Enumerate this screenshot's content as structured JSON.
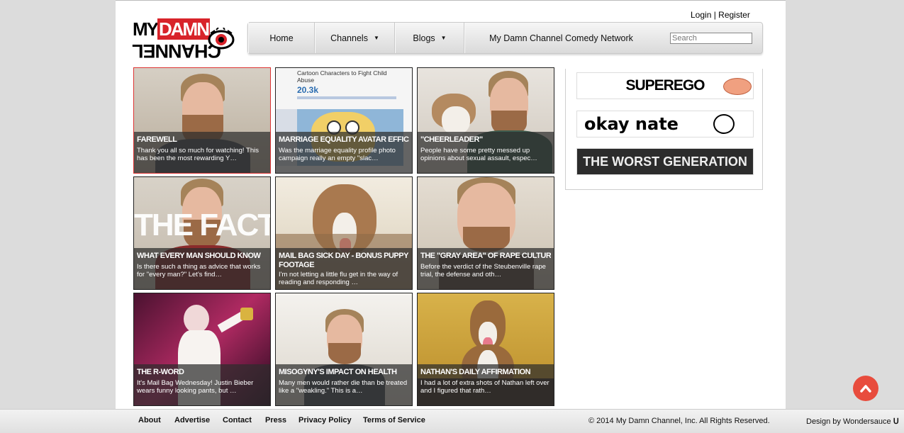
{
  "header": {
    "logo": {
      "word_top_black": "MY",
      "word_top_red": "DAMN",
      "word_bottom": "CHANNEL"
    },
    "login_label": "Login",
    "separator": " | ",
    "register_label": "Register"
  },
  "nav": {
    "home": "Home",
    "channels": "Channels",
    "blogs": "Blogs",
    "network": "My Damn Channel Comedy Network",
    "search_placeholder": "Search",
    "caret": "▼"
  },
  "videos": [
    {
      "title": "Farewell",
      "desc": "Thank you all so much for watching! This has been the most rewarding Y…"
    },
    {
      "title": "Marriage Equality Avatar Efficacy",
      "desc": "Was the marriage equality profile photo campaign really an empty \"slac…",
      "screen_text": "Cartoon Characters to Fight Child Abuse",
      "screen_count": "20.3k"
    },
    {
      "title": "\"Cheerleader\"",
      "desc": "People have some pretty messed up opinions about sexual assault, espec…"
    },
    {
      "title": "What Every Man Should Know",
      "desc": "Is there such a thing as advice that works for \"every man?\" Let's find…",
      "screen_text": "THE FACT"
    },
    {
      "title": "Mail Bag Sick Day - Bonus Puppy Footage",
      "desc": "I'm not letting a little flu get in the way of reading and responding …"
    },
    {
      "title": "The \"Gray Area\" of Rape Culture",
      "desc": "Before the verdict of the Steubenville rape trial, the defense and oth…"
    },
    {
      "title": "The R-Word",
      "desc": "It's Mail Bag Wednesday! Justin Bieber wears funny looking pants, but …"
    },
    {
      "title": "Misogyny's Impact on Health",
      "desc": "Many men would rather die than be treated like a \"weakling.\" This is a…"
    },
    {
      "title": "Nathan's Daily Affirmation",
      "desc": "I had a lot of extra shots of Nathan left over and I figured that rath…"
    }
  ],
  "sidebar": {
    "banners": [
      "SUPEREGO",
      "okay nate",
      "THE WORST GENERATION"
    ]
  },
  "footer": {
    "links": [
      "About",
      "Advertise",
      "Contact",
      "Press",
      "Privacy Policy",
      "Terms of Service"
    ],
    "copyright": "© 2014 My Damn Channel, Inc. All Rights Reserved.",
    "design_prefix": "Design by ",
    "design_name": "Wondersauce"
  },
  "colors": {
    "accent_red": "#d8232a",
    "scroll_button": "#e84c3d",
    "overlay": "#2d2d2d"
  },
  "icons": {
    "eye": "eye-icon",
    "scroll_top": "chevron-up-icon",
    "wondersauce": "wondersauce-logo-icon"
  }
}
